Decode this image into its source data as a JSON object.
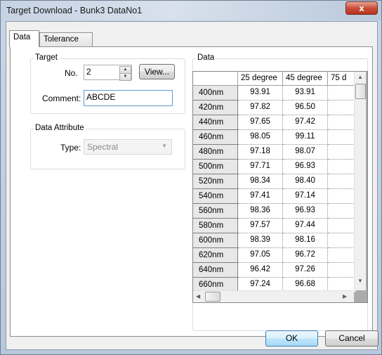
{
  "window": {
    "title": "Target Download - Bunk3 DataNo1",
    "close_label": "x"
  },
  "tabs": [
    {
      "label": "Data"
    },
    {
      "label": "Tolerance"
    }
  ],
  "target_group": {
    "title": "Target",
    "no_label": "No.",
    "no_value": "2",
    "view_label": "View...",
    "comment_label": "Comment:",
    "comment_value": "ABCDE"
  },
  "attr_group": {
    "title": "Data Attribute",
    "type_label": "Type:",
    "type_value": "Spectral"
  },
  "data_group": {
    "title": "Data",
    "columns": [
      "25 degree",
      "45 degree",
      "75 d"
    ],
    "rows": [
      {
        "label": "400nm",
        "v": [
          "93.91",
          "93.91"
        ]
      },
      {
        "label": "420nm",
        "v": [
          "97.82",
          "96.50"
        ]
      },
      {
        "label": "440nm",
        "v": [
          "97.65",
          "97.42"
        ]
      },
      {
        "label": "460nm",
        "v": [
          "98.05",
          "99.11"
        ]
      },
      {
        "label": "480nm",
        "v": [
          "97.18",
          "98.07"
        ]
      },
      {
        "label": "500nm",
        "v": [
          "97.71",
          "96.93"
        ]
      },
      {
        "label": "520nm",
        "v": [
          "98.34",
          "98.40"
        ]
      },
      {
        "label": "540nm",
        "v": [
          "97.41",
          "97.14"
        ]
      },
      {
        "label": "560nm",
        "v": [
          "98.36",
          "96.93"
        ]
      },
      {
        "label": "580nm",
        "v": [
          "97.57",
          "97.44"
        ]
      },
      {
        "label": "600nm",
        "v": [
          "98.39",
          "98.16"
        ]
      },
      {
        "label": "620nm",
        "v": [
          "97.05",
          "96.72"
        ]
      },
      {
        "label": "640nm",
        "v": [
          "96.42",
          "97.26"
        ]
      },
      {
        "label": "660nm",
        "v": [
          "97.24",
          "96.68"
        ]
      }
    ]
  },
  "footer": {
    "ok_label": "OK",
    "cancel_label": "Cancel"
  }
}
